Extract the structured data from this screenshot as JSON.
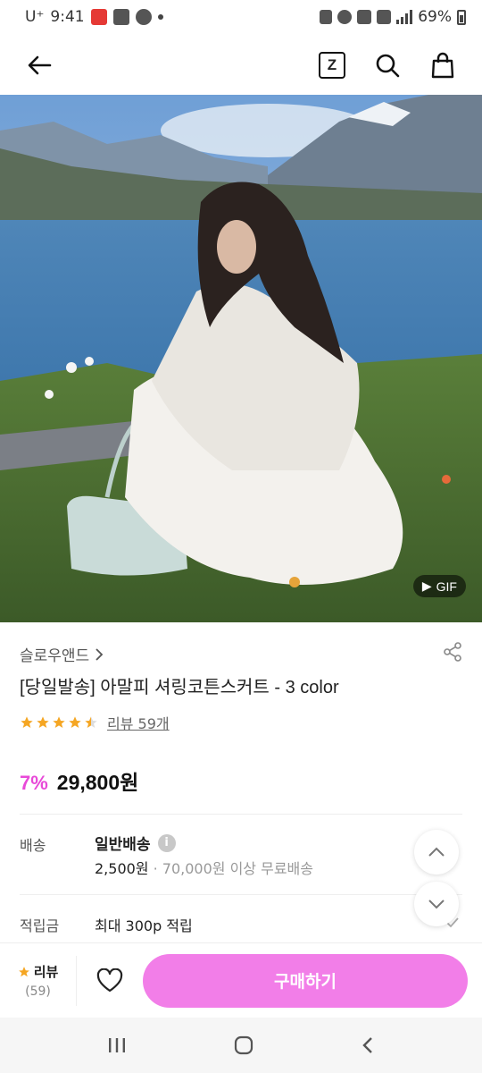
{
  "status": {
    "carrier": "U⁺",
    "time": "9:41",
    "battery": "69%"
  },
  "header": {
    "back_icon": "arrow-left-icon",
    "z_label": "Z",
    "search_icon": "search-icon",
    "cart_icon": "shopping-bag-icon"
  },
  "hero": {
    "badge": "GIF"
  },
  "product": {
    "brand": "슬로우앤드",
    "title": "[당일발송] 아말피 셔링코튼스커트 - 3 color",
    "rating": 4.5,
    "review_link": "리뷰 59개",
    "discount": "7%",
    "price": "29,800원"
  },
  "shipping": {
    "label": "배송",
    "method": "일반배송",
    "fee": "2,500원",
    "free_note": " · 70,000원 이상 무료배송"
  },
  "points": {
    "label": "적립금",
    "value": "최대 300p 적립"
  },
  "bottom": {
    "review_title": "리뷰",
    "review_count": "(59)",
    "buy_label": "구매하기"
  },
  "colors": {
    "accent": "#f27ee8",
    "discount": "#e84ad8",
    "star": "#f5a623"
  }
}
